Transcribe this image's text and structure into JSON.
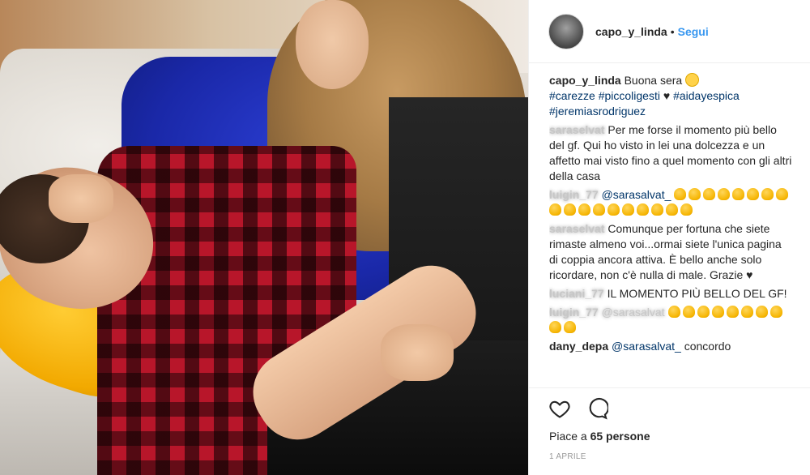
{
  "post": {
    "username": "capo_y_linda",
    "follow_label": "Segui",
    "separator": "•"
  },
  "caption": {
    "user": "capo_y_linda",
    "text": "Buona sera",
    "tags": [
      "#carezze",
      "#piccoligesti",
      "#aidayespica",
      "#jeremiasrodriguez"
    ],
    "heart": "♥"
  },
  "comments": [
    {
      "user": "saraselvat",
      "text": "Per me forse il momento più bello del gf. Qui ho visto in lei una dolcezza e un affetto mai visto fino a quel momento con gli altri della casa"
    },
    {
      "user": "luigin_77",
      "mention": "@sarasalvat_",
      "claps": 18
    },
    {
      "user": "saraselvat",
      "text": "Comunque per fortuna che siete rimaste almeno voi...ormai siete l'unica pagina di coppia ancora attiva. È bello anche solo ricordare, non c'è nulla di male. Grazie",
      "heart": "♥"
    },
    {
      "user": "luciani_77",
      "text": "IL MOMENTO PIÙ BELLO DEL GF!"
    },
    {
      "user": "luigin_77",
      "mention": "@sarasalvat",
      "claps": 10
    },
    {
      "user": "dany_depa",
      "mention": "@sarasalvat_",
      "text": "concordo"
    }
  ],
  "likes": {
    "prefix": "Piace a ",
    "count": "65",
    "suffix": " persone"
  },
  "date": "1 APRILE",
  "icons": [
    "heart-icon",
    "comment-icon"
  ],
  "colors": {
    "link": "#3897f0",
    "hashtag": "#003569"
  }
}
